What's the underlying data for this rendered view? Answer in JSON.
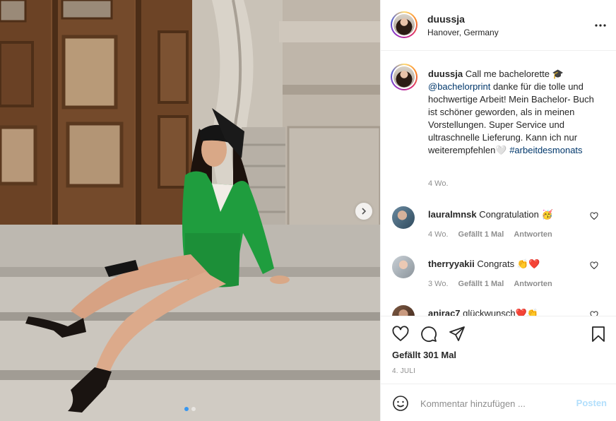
{
  "post": {
    "username": "duussja",
    "location": "Hanover, Germany",
    "caption": {
      "username": "duussja",
      "text_1": "Call me bachelorette 🎓",
      "mention": "@bachelorprint",
      "text_2": " danke für die tolle und hochwertige Arbeit! Mein Bachelor- Buch ist schöner geworden, als in meinen Vorstellungen. Super Service und ultraschnelle Lieferung. Kann ich nur weiterempfehlen🤍",
      "hashtag": "#arbeitdesmonats",
      "time": "4 Wo."
    },
    "comments": [
      {
        "username": "lauralmnsk",
        "text": "Congratulation 🥳",
        "time": "4 Wo.",
        "likes": "Gefällt 1 Mal",
        "reply": "Antworten"
      },
      {
        "username": "therryyakii",
        "text": "Congrats 👏❤️",
        "time": "3 Wo.",
        "likes": "Gefällt 1 Mal",
        "reply": "Antworten"
      },
      {
        "username": "anjrac7",
        "text": "glückwunsch❤️👏",
        "time": "",
        "likes": "",
        "reply": ""
      }
    ],
    "likes_text": "Gefällt 301 Mal",
    "date": "4. JULI",
    "comment_placeholder": "Kommentar hinzufügen ...",
    "post_button": "Posten"
  },
  "icons": {
    "more": "more-horizontal-icon",
    "like": "heart-icon",
    "comment": "comment-icon",
    "share": "paper-plane-icon",
    "save": "bookmark-icon",
    "emoji": "emoji-icon",
    "next": "chevron-right-icon"
  },
  "colors": {
    "link": "#00376b",
    "muted": "#8e8e8e",
    "post_disabled": "#b2dffc",
    "dot_active": "#3897f0",
    "jacket": "#1f9d3e"
  }
}
